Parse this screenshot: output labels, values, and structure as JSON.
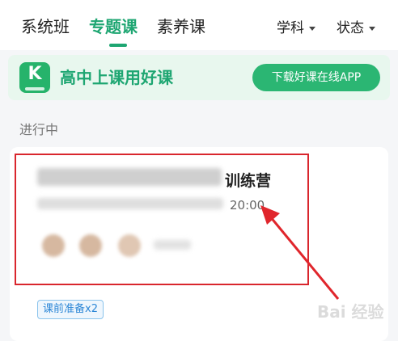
{
  "tabs": [
    {
      "label": "系统班",
      "active": false
    },
    {
      "label": "专题课",
      "active": true
    },
    {
      "label": "素养课",
      "active": false
    }
  ],
  "filters": {
    "subject": "学科",
    "status": "状态"
  },
  "banner": {
    "logo_letter": "K",
    "title": "高中上课用好课",
    "button_label": "下载好课在线APP"
  },
  "section": {
    "label": "进行中"
  },
  "course_card": {
    "title_visible": "训练营",
    "time_visible": "20:00",
    "badge": "课前准备x2"
  },
  "colors": {
    "accent": "#1ea672",
    "banner_bg": "#e8f7ee",
    "highlight": "#d9262d",
    "badge_text": "#2b86d6"
  },
  "watermark": "Bai 经验"
}
